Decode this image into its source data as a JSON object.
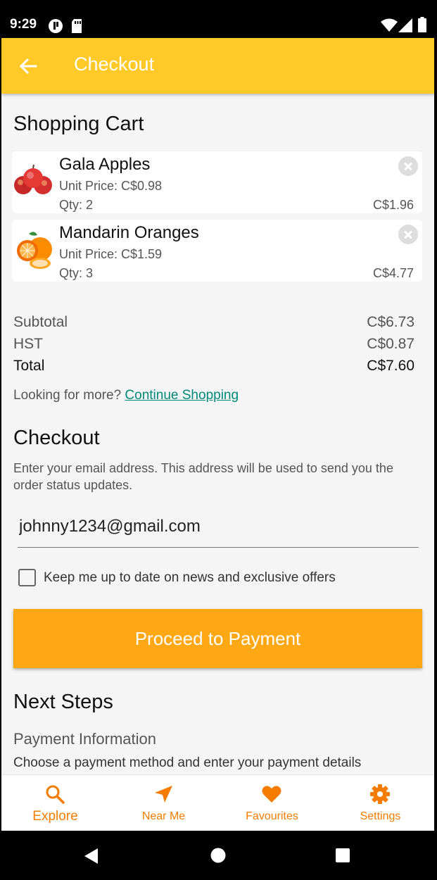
{
  "status_bar": {
    "time": "9:29"
  },
  "app_bar": {
    "title": "Checkout"
  },
  "cart": {
    "heading": "Shopping Cart",
    "items": [
      {
        "name": "Gala Apples",
        "unit_price": "Unit Price: C$0.98",
        "qty": "Qty: 2",
        "total": "C$1.96",
        "image": "apple-image"
      },
      {
        "name": "Mandarin Oranges",
        "unit_price": "Unit Price: C$1.59",
        "qty": "Qty: 3",
        "total": "C$4.77",
        "image": "orange-image"
      }
    ]
  },
  "summary": {
    "subtotal_label": "Subtotal",
    "subtotal": "C$6.73",
    "hst_label": "HST",
    "hst": "C$0.87",
    "total_label": "Total",
    "total": "C$7.60"
  },
  "more": {
    "text": "Looking for more? ",
    "link": "Continue Shopping"
  },
  "checkout": {
    "heading": "Checkout",
    "description": "Enter your email address. This address will be used to send you the order status updates.",
    "email_value": "johnny1234@gmail.com",
    "newsletter_label": "Keep me up to date on news and exclusive offers",
    "newsletter_checked": false,
    "proceed_label": "Proceed to Payment"
  },
  "next_steps": {
    "heading": "Next Steps",
    "step_title": "Payment Information",
    "step_desc": "Choose a payment method and enter your payment details"
  },
  "bottom_nav": {
    "active": "Explore",
    "items": [
      {
        "label": "Explore",
        "icon": "search-icon"
      },
      {
        "label": "Near Me",
        "icon": "navigation-icon"
      },
      {
        "label": "Favourites",
        "icon": "heart-icon"
      },
      {
        "label": "Settings",
        "icon": "gear-icon"
      }
    ]
  },
  "colors": {
    "app_bar": "#ffca28",
    "button": "#ffa814",
    "nav_accent": "#f57c00",
    "link": "#00897b"
  }
}
